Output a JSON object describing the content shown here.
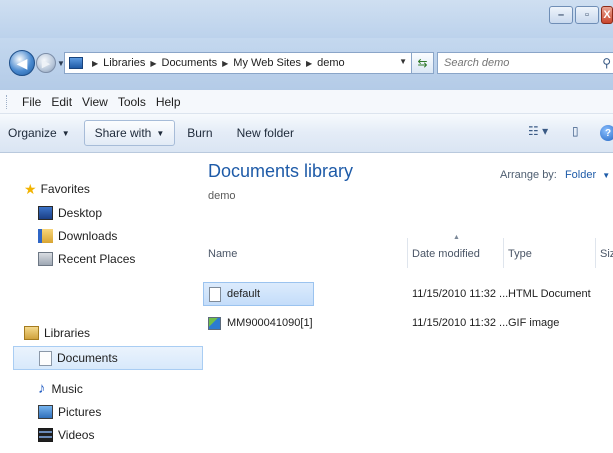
{
  "window": {
    "controls": {
      "minimize": "–",
      "maximize": "▫",
      "close": "X"
    }
  },
  "address_bar": {
    "crumbs": [
      "Libraries",
      "Documents",
      "My Web Sites",
      "demo"
    ]
  },
  "search": {
    "placeholder": "Search demo"
  },
  "menu": [
    "File",
    "Edit",
    "View",
    "Tools",
    "Help"
  ],
  "commands": {
    "organize": "Organize",
    "share_with": "Share with",
    "burn": "Burn",
    "new_folder": "New folder"
  },
  "nav": {
    "favorites_label": "Favorites",
    "favorites": [
      "Desktop",
      "Downloads",
      "Recent Places"
    ],
    "libraries_label": "Libraries",
    "libraries": [
      "Documents",
      "Music",
      "Pictures",
      "Videos"
    ],
    "selected": "Documents"
  },
  "content": {
    "title": "Documents library",
    "subtitle": "demo",
    "arrange_label": "Arrange by:",
    "arrange_value": "Folder",
    "columns": [
      "Name",
      "Date modified",
      "Type",
      "Size"
    ],
    "files": [
      {
        "name": "default",
        "date": "11/15/2010 11:32 ...",
        "type": "HTML Document",
        "icon": "html-file-icon",
        "selected": true
      },
      {
        "name": "MM900041090[1]",
        "date": "11/15/2010 11:32 ...",
        "type": "GIF image",
        "icon": "gif-image-icon",
        "selected": false
      }
    ]
  },
  "colors": {
    "accent": "#1e5ba8",
    "titlebar": "#c4d8ef",
    "selection": "#cde3fb"
  }
}
